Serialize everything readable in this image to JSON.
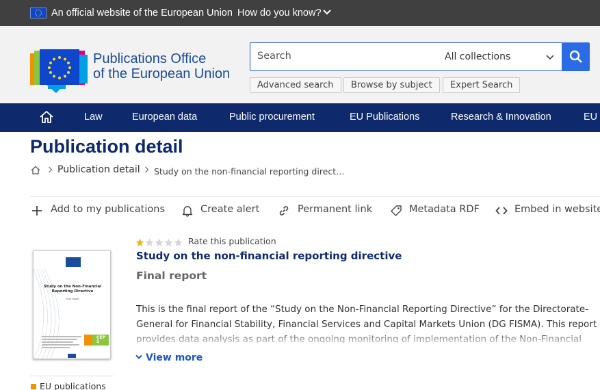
{
  "eu_bar": {
    "official_text": "An official website of the European Union",
    "how_know": "How do you know?"
  },
  "logo": {
    "line1": "Publications Office",
    "line2": "of the European Union"
  },
  "search": {
    "placeholder": "Search",
    "scope": "All collections",
    "buttons": [
      "Advanced search",
      "Browse by subject",
      "Expert Search"
    ]
  },
  "nav": {
    "items": [
      "Law",
      "European data",
      "Public procurement",
      "EU Publications",
      "Research & Innovation",
      "EU W"
    ]
  },
  "page": {
    "title": "Publication detail",
    "breadcrumb": {
      "link": "Publication detail",
      "current": "Study on the non-financial reporting direct…"
    },
    "actions": [
      "Add to my publications",
      "Create alert",
      "Permanent link",
      "Metadata RDF",
      "Embed in website"
    ]
  },
  "publication": {
    "rating": {
      "value": 1,
      "max": 5,
      "label": "Rate this publication"
    },
    "title": "Study on the non-financial reporting directive",
    "subtitle": "Final report",
    "abstract": "This is the final report of the “Study on the Non-Financial Reporting Directive” for the Directorate-General for Financial Stability, Financial Services and Capital Markets Union (DG FISMA). This report provides data analysis as part of the ongoing monitoring of implementation of the Non-Financial",
    "view_more": "View more",
    "cover": {
      "title": "Study on the Non-Financial Reporting Directive",
      "subtitle": "Final report",
      "logo_text": "CEPS"
    },
    "tag": "EU publications"
  },
  "colors": {
    "eu_bar": "#404040",
    "header_bg": "#f2f2f2",
    "nav_bg": "#0e2a6c",
    "brand_blue": "#1a4b9c",
    "search_button": "#2b6be5",
    "link_blue": "#1b55c9",
    "star_filled": "#f2b51d",
    "tag_orange": "#f39200"
  }
}
